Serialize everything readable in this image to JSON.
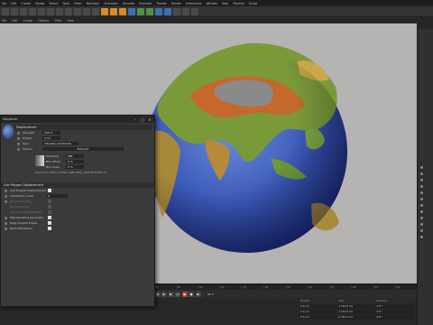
{
  "menubar": {
    "items": [
      "File",
      "Edit",
      "Create",
      "Modes",
      "Select",
      "Tools",
      "Mesh",
      "MoGraph",
      "Character",
      "Animate",
      "Simulate",
      "Tracker",
      "Render",
      "Extensions",
      "Window",
      "Help",
      "Pipeline",
      "Script"
    ]
  },
  "subbar": {
    "items": [
      "File",
      "Edit",
      "Create",
      "Options",
      "Filter",
      "View"
    ]
  },
  "dialog": {
    "title": "Displacer",
    "section_displacement": "Displacement",
    "strength_label": "Strength",
    "strength_value": "100 %",
    "height_label": "Height",
    "height_value": "3 cm",
    "type_label": "Type",
    "type_value": "Intensity (Centered)",
    "texture_label": "Texture",
    "texture_value": "Bump.tif",
    "sampling_label": "Sampling",
    "sampling_value": "MIP",
    "blur_offset_label": "Blur Offset",
    "blur_offset_value": "0 %",
    "blur_scale_label": "Blur Scale",
    "blur_scale_value": "0 %",
    "resolution_text": "Resolution 21600 x 10800, RGB (8 Bit), sRGB IEC61966-2.1",
    "section_subpoly": "Sub Polygon Displacement",
    "subpoly_items": [
      {
        "label": "Sub Polygon Displacement",
        "checked": true
      },
      {
        "label": "Subdivision Level",
        "value": "6"
      },
      {
        "label": "Round Geometry",
        "checked": false
      },
      {
        "label": "Round Contour",
        "checked": false
      },
      {
        "label": "Map Rounded Geometry",
        "checked": false
      },
      {
        "label": "Map Resulting Geometry",
        "checked": true
      },
      {
        "label": "Keep Original Edges",
        "checked": true
      },
      {
        "label": "Best Distribution",
        "checked": true
      }
    ]
  },
  "timeline": {
    "ruler": [
      "0",
      "5",
      "10",
      "15",
      "20",
      "25",
      "30",
      "35",
      "40",
      "45",
      "50",
      "55",
      "60",
      "65",
      "70",
      "75",
      "80",
      "85",
      "90"
    ],
    "current_frame": "0 F",
    "end_frame": "90 F",
    "coords_headers": [
      "Position",
      "Size",
      "Rotation"
    ],
    "coords_rows": [
      [
        "X  0 cm",
        "X  167.5 cm",
        "H  0 °"
      ],
      [
        "Y  0 cm",
        "Y  167.8 cm",
        "P  0 °"
      ],
      [
        "Z  0 cm",
        "Z  167.5 cm",
        "B  0 °"
      ]
    ]
  },
  "colors": {
    "accent": "#d98b2b",
    "viewport_bg": "#b6b3b3",
    "ui_dark": "#2b2b2b"
  }
}
